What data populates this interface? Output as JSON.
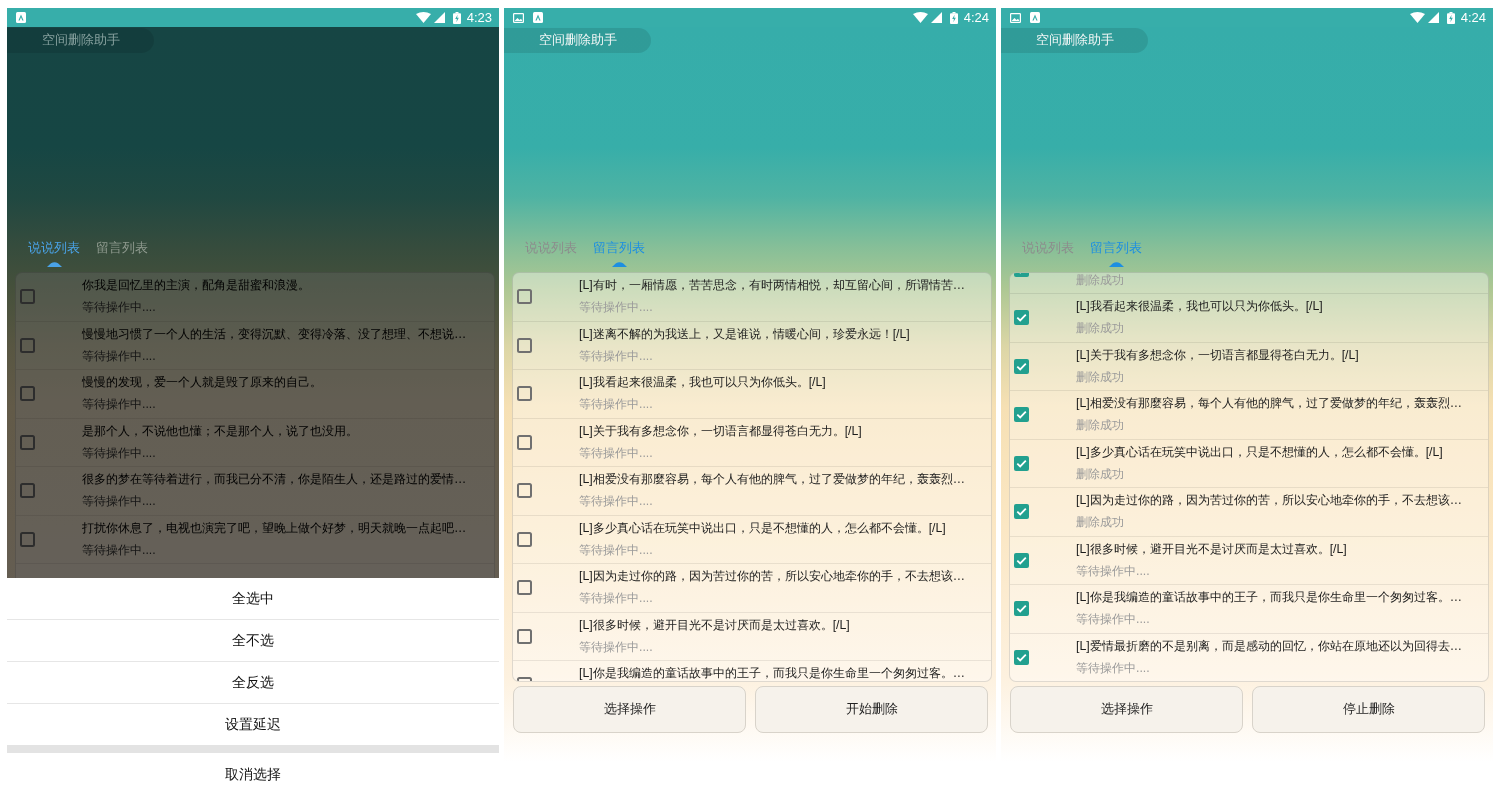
{
  "panels": [
    {
      "dimmed": true,
      "status_bar": {
        "notifications": [
          {
            "kind": "app"
          }
        ],
        "time": "4:23"
      },
      "title": "空间删除助手",
      "tabs": [
        {
          "label": "说说列表",
          "selected": true
        },
        {
          "label": "留言列表",
          "selected": false
        }
      ],
      "list": {
        "rows": [
          {
            "title": "你我是回忆里的主演，配角是甜蜜和浪漫。",
            "status": "等待操作中....",
            "checked": false
          },
          {
            "title": "慢慢地习惯了一个人的生活，变得沉默、变得冷落、没了想理、不想说…",
            "status": "等待操作中....",
            "checked": false
          },
          {
            "title": "慢慢的发现，爱一个人就是毁了原来的自己。",
            "status": "等待操作中....",
            "checked": false
          },
          {
            "title": "是那个人，不说他也懂；不是那个人，说了也没用。",
            "status": "等待操作中....",
            "checked": false
          },
          {
            "title": "很多的梦在等待着进行，而我已分不清，你是陌生人，还是路过的爱情…",
            "status": "等待操作中....",
            "checked": false
          },
          {
            "title": "打扰你休息了，电视也演完了吧，望晚上做个好梦，明天就晚一点起吧…",
            "status": "等待操作中....",
            "checked": false
          }
        ]
      },
      "sheet": {
        "items": [
          "全选中",
          "全不选",
          "全反选",
          "设置延迟"
        ],
        "cancel": "取消选择"
      }
    },
    {
      "dimmed": false,
      "status_bar": {
        "notifications": [
          {
            "kind": "image"
          },
          {
            "kind": "app"
          }
        ],
        "time": "4:24"
      },
      "title": "空间删除助手",
      "tabs": [
        {
          "label": "说说列表",
          "selected": false
        },
        {
          "label": "留言列表",
          "selected": true
        }
      ],
      "list": {
        "rows": [
          {
            "title": "[L]有时，一厢情愿，苦苦思念，有时两情相悦，却互留心间，所谓情苦…",
            "status": "等待操作中....",
            "checked": false
          },
          {
            "title": "[L]迷离不解的为我送上，又是谁说，情暖心间，珍爱永远！[/L]",
            "status": "等待操作中....",
            "checked": false
          },
          {
            "title": "[L]我看起来很温柔，我也可以只为你低头。[/L]",
            "status": "等待操作中....",
            "checked": false
          },
          {
            "title": "[L]关于我有多想念你，一切语言都显得苍白无力。[/L]",
            "status": "等待操作中....",
            "checked": false
          },
          {
            "title": "[L]相爱没有那麼容易，每个人有他的脾气，过了爱做梦的年纪，轰轰烈…",
            "status": "等待操作中....",
            "checked": false
          },
          {
            "title": "[L]多少真心话在玩笑中说出口，只是不想懂的人，怎么都不会懂。[/L]",
            "status": "等待操作中....",
            "checked": false
          },
          {
            "title": "[L]因为走过你的路，因为苦过你的苦，所以安心地牵你的手，不去想该…",
            "status": "等待操作中....",
            "checked": false
          },
          {
            "title": "[L]很多时候，避开目光不是讨厌而是太过喜欢。[/L]",
            "status": "等待操作中....",
            "checked": false
          },
          {
            "title": "[L]你是我编造的童话故事中的王子，而我只是你生命里一个匆匆过客。…",
            "checked": false
          }
        ]
      },
      "buttons": [
        "选择操作",
        "开始删除"
      ]
    },
    {
      "dimmed": false,
      "status_bar": {
        "notifications": [
          {
            "kind": "image"
          },
          {
            "kind": "app"
          }
        ],
        "time": "4:24"
      },
      "title": "空间删除助手",
      "tabs": [
        {
          "label": "说说列表",
          "selected": false
        },
        {
          "label": "留言列表",
          "selected": true
        }
      ],
      "list": {
        "rows": [
          {
            "status": "删除成功",
            "checked": true
          },
          {
            "title": "[L]我看起来很温柔，我也可以只为你低头。[/L]",
            "status": "删除成功",
            "checked": true
          },
          {
            "title": "[L]关于我有多想念你，一切语言都显得苍白无力。[/L]",
            "status": "删除成功",
            "checked": true
          },
          {
            "title": "[L]相爱没有那麼容易，每个人有他的脾气，过了爱做梦的年纪，轰轰烈…",
            "status": "删除成功",
            "checked": true
          },
          {
            "title": "[L]多少真心话在玩笑中说出口，只是不想懂的人，怎么都不会懂。[/L]",
            "status": "删除成功",
            "checked": true
          },
          {
            "title": "[L]因为走过你的路，因为苦过你的苦，所以安心地牵你的手，不去想该…",
            "status": "删除成功",
            "checked": true
          },
          {
            "title": "[L]很多时候，避开目光不是讨厌而是太过喜欢。[/L]",
            "status": "等待操作中....",
            "checked": true
          },
          {
            "title": "[L]你是我编造的童话故事中的王子，而我只是你生命里一个匆匆过客。…",
            "status": "等待操作中....",
            "checked": true
          },
          {
            "title": "[L]爱情最折磨的不是别离，而是感动的回忆，你站在原地还以为回得去…",
            "status": "等待操作中....",
            "checked": true
          }
        ]
      },
      "buttons": [
        "选择操作",
        "停止删除"
      ]
    }
  ]
}
